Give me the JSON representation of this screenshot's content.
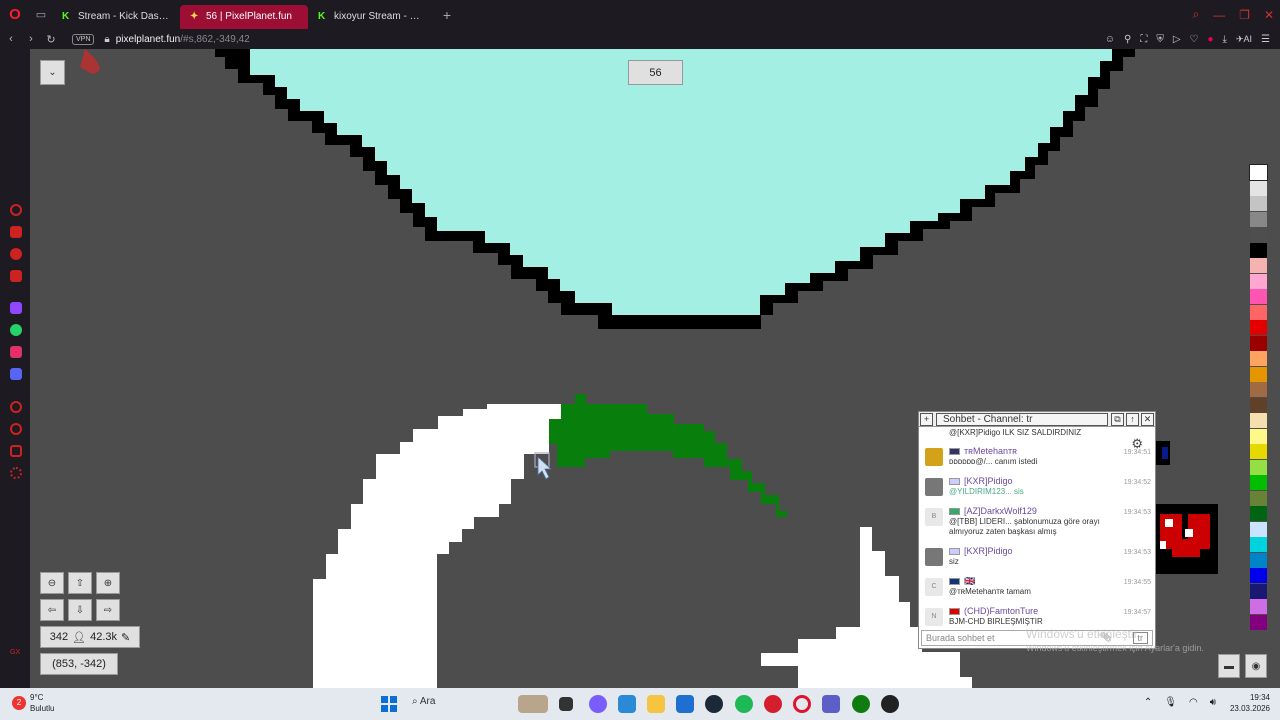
{
  "browser": {
    "tabs": [
      {
        "title": "Stream - Kick Dashboard",
        "favicon": "K"
      },
      {
        "title": "56 | PixelPlanet.fun",
        "favicon": "PP",
        "active": true
      },
      {
        "title": "kixoyur Stream - Watch Li...",
        "favicon": "K"
      }
    ],
    "new_tab": "+",
    "vpn_label": "VPN",
    "url_host": "pixelplanet.fun",
    "url_path": "/#s,862,-349,42",
    "ai_label": "AI"
  },
  "pixelplanet": {
    "online_title": "56",
    "users_count": "342",
    "pixels_count": "42.3k",
    "coordinates": "(853, -342)",
    "menu_toggle": "⌄",
    "zoom_out": "⊖",
    "up": "⇧",
    "zoom_in": "⊕",
    "left": "⇦",
    "down": "⇩",
    "right": "⇨",
    "palette": [
      "#ffffff",
      "#e4e4e4",
      "#c4c4c4",
      "#888888",
      "#4e4e4e",
      "#000000",
      "#f4b3ae",
      "#ffa7d1",
      "#ff54b2",
      "#ff6565",
      "#e50000",
      "#9a0000",
      "#fea460",
      "#e59500",
      "#a06a42",
      "#604028",
      "#f5dfb0",
      "#fff889",
      "#e5d900",
      "#94e044",
      "#02be01",
      "#688338",
      "#006513",
      "#cae3ff",
      "#00d3dd",
      "#0083c7",
      "#0000ea",
      "#191973",
      "#cf6ee4",
      "#820080"
    ]
  },
  "chat": {
    "title": "Sohbet - Channel: tr",
    "input_placeholder": "Burada sohbet et",
    "lang": "tr",
    "messages": [
      {
        "nick": "",
        "text": "@[KXR]Pidigo ILK SIZ SALDIRDINIZ",
        "time": ""
      },
      {
        "nick": "ᴛʀMetehanᴛʀ",
        "text": "ᴅᴅᴅᴅᴅᴅ@/... canım istedi",
        "time": "19:34:51"
      },
      {
        "nick": "[KXR]Pidigo",
        "text": "@YILDIRIM123... sis",
        "time": "19:34:52"
      },
      {
        "nick": "[AZ]DarkxWolf129",
        "text": "@[TBB] LIDERI... şablonumuza göre orayı almıyoruz zaten başkası almış",
        "time": "19:34:53"
      },
      {
        "nick": "[KXR]Pidigo",
        "text": "siz",
        "time": "19:34:53"
      },
      {
        "nick": "🇬🇧",
        "text": "@ᴛʀMetehanᴛʀ tamam",
        "time": "19:34:55"
      },
      {
        "nick": "(CHD)FamtonTure",
        "text": "BJM-CHD BIRLEŞMIŞTIR",
        "time": "19:34:57"
      }
    ]
  },
  "watermark": {
    "line1": "Windows'u etkinleştir",
    "line2": "Windows'u etkinleştirmek için Ayarlar'a gidin."
  },
  "taskbar": {
    "temperature": "9°C",
    "weather": "Bulutlu",
    "weather_badge": "2",
    "search": "Ara",
    "time": "19:34",
    "date": "23.03.2026"
  }
}
